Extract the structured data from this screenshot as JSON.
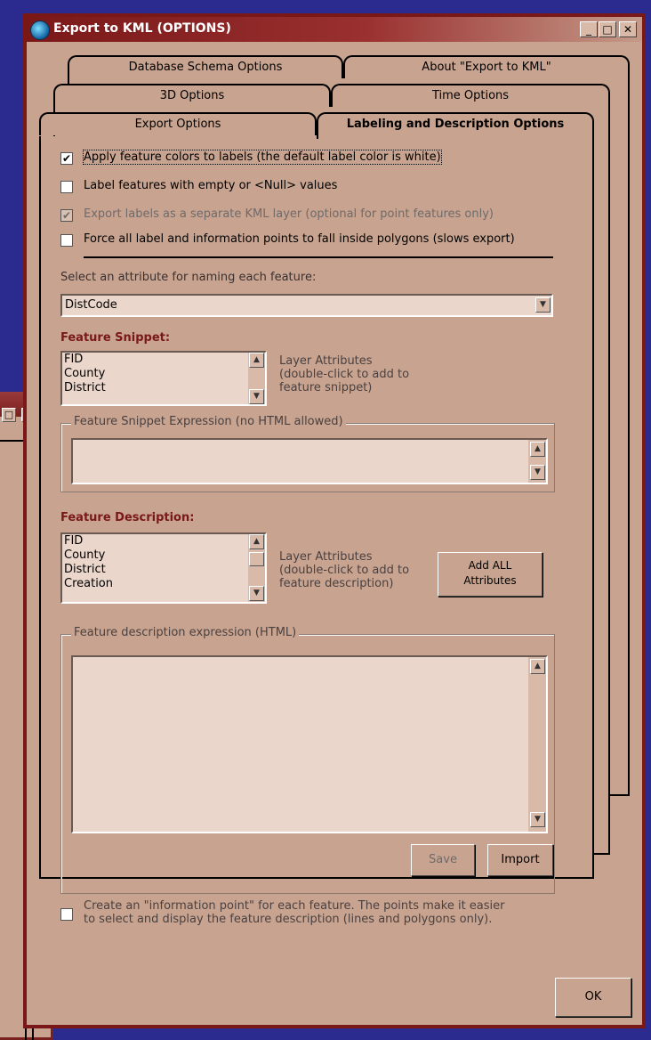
{
  "window": {
    "title": "Export to KML (OPTIONS)",
    "minimize": "_",
    "maximize": "□",
    "close": "✕"
  },
  "background_window": {
    "maximize": "□",
    "close": "✕"
  },
  "tabs": {
    "row1": [
      "Database Schema Options",
      "About \"Export to KML\""
    ],
    "row2": [
      "3D Options",
      "Time Options"
    ],
    "row3": [
      "Export Options",
      "Labeling and Description Options"
    ]
  },
  "options": {
    "apply_colors": {
      "label": "Apply feature colors to labels (the default label color is white)",
      "checked": true
    },
    "label_empty": {
      "label": "Label features with empty or <Null> values",
      "checked": false
    },
    "export_separate": {
      "label": "Export labels as a separate KML layer (optional for point features only)",
      "checked": true
    },
    "force_inside": {
      "label": "Force all label and information points to fall inside polygons (slows export)",
      "checked": false
    }
  },
  "naming": {
    "prompt": "Select an attribute for naming each feature:",
    "selected": "DistCode"
  },
  "snippet": {
    "heading": "Feature Snippet:",
    "attributes": [
      "FID",
      "County",
      "District"
    ],
    "hint": [
      "Layer Attributes",
      "(double-click to add to",
      "feature snippet)"
    ],
    "expression_legend": "Feature Snippet Expression (no HTML allowed)"
  },
  "description": {
    "heading": "Feature Description:",
    "attributes": [
      "FID",
      "County",
      "District",
      "Creation"
    ],
    "hint": [
      "Layer Attributes",
      "(double-click to add to",
      "feature description)"
    ],
    "add_all": [
      "Add ALL",
      "Attributes"
    ],
    "expression_legend": "Feature description expression (HTML)",
    "save": "Save",
    "import": "Import"
  },
  "info_point": {
    "lines": [
      "Create an \"information point\" for each feature. The points make it easier",
      "to select and display the feature description (lines and polygons only)."
    ],
    "checked": false
  },
  "ok": "OK",
  "colors": {
    "frame": "#7a1818",
    "panel": "#c8a490",
    "desktop": "#2b2a8f"
  }
}
